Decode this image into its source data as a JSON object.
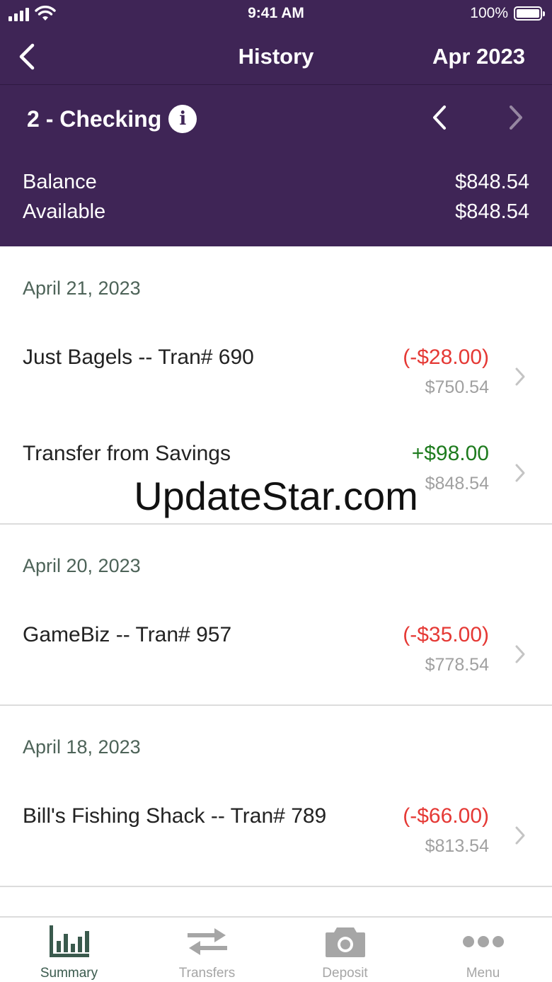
{
  "status_bar": {
    "time": "9:41 AM",
    "battery": "100%"
  },
  "nav": {
    "title": "History",
    "month": "Apr 2023"
  },
  "account": {
    "name": "2 - Checking",
    "info_glyph": "i"
  },
  "balances": [
    {
      "label": "Balance",
      "value": "$848.54"
    },
    {
      "label": "Available",
      "value": "$848.54"
    }
  ],
  "groups": [
    {
      "date": "April 21, 2023",
      "transactions": [
        {
          "description": "Just Bagels -- Tran# 690",
          "amount": "(-$28.00)",
          "kind": "debit",
          "running_balance": "$750.54"
        },
        {
          "description": "Transfer from Savings",
          "amount": "+$98.00",
          "kind": "credit",
          "running_balance": "$848.54"
        }
      ]
    },
    {
      "date": "April 20, 2023",
      "transactions": [
        {
          "description": "GameBiz -- Tran# 957",
          "amount": "(-$35.00)",
          "kind": "debit",
          "running_balance": "$778.54"
        }
      ]
    },
    {
      "date": "April 18, 2023",
      "transactions": [
        {
          "description": "Bill's Fishing Shack -- Tran# 789",
          "amount": "(-$66.00)",
          "kind": "debit",
          "running_balance": "$813.54"
        }
      ]
    }
  ],
  "watermark": "UpdateStar.com",
  "tabs": [
    {
      "label": "Summary",
      "icon": "bar-chart-icon",
      "active": true
    },
    {
      "label": "Transfers",
      "icon": "transfer-arrows-icon",
      "active": false
    },
    {
      "label": "Deposit",
      "icon": "camera-icon",
      "active": false
    },
    {
      "label": "Menu",
      "icon": "more-dots-icon",
      "active": false
    }
  ],
  "colors": {
    "header_bg": "#3f2556",
    "debit": "#e53935",
    "credit": "#1e7b1e",
    "muted": "#a0a0a0",
    "date_header": "#4d6358",
    "tab_active": "#3a5a4d"
  }
}
